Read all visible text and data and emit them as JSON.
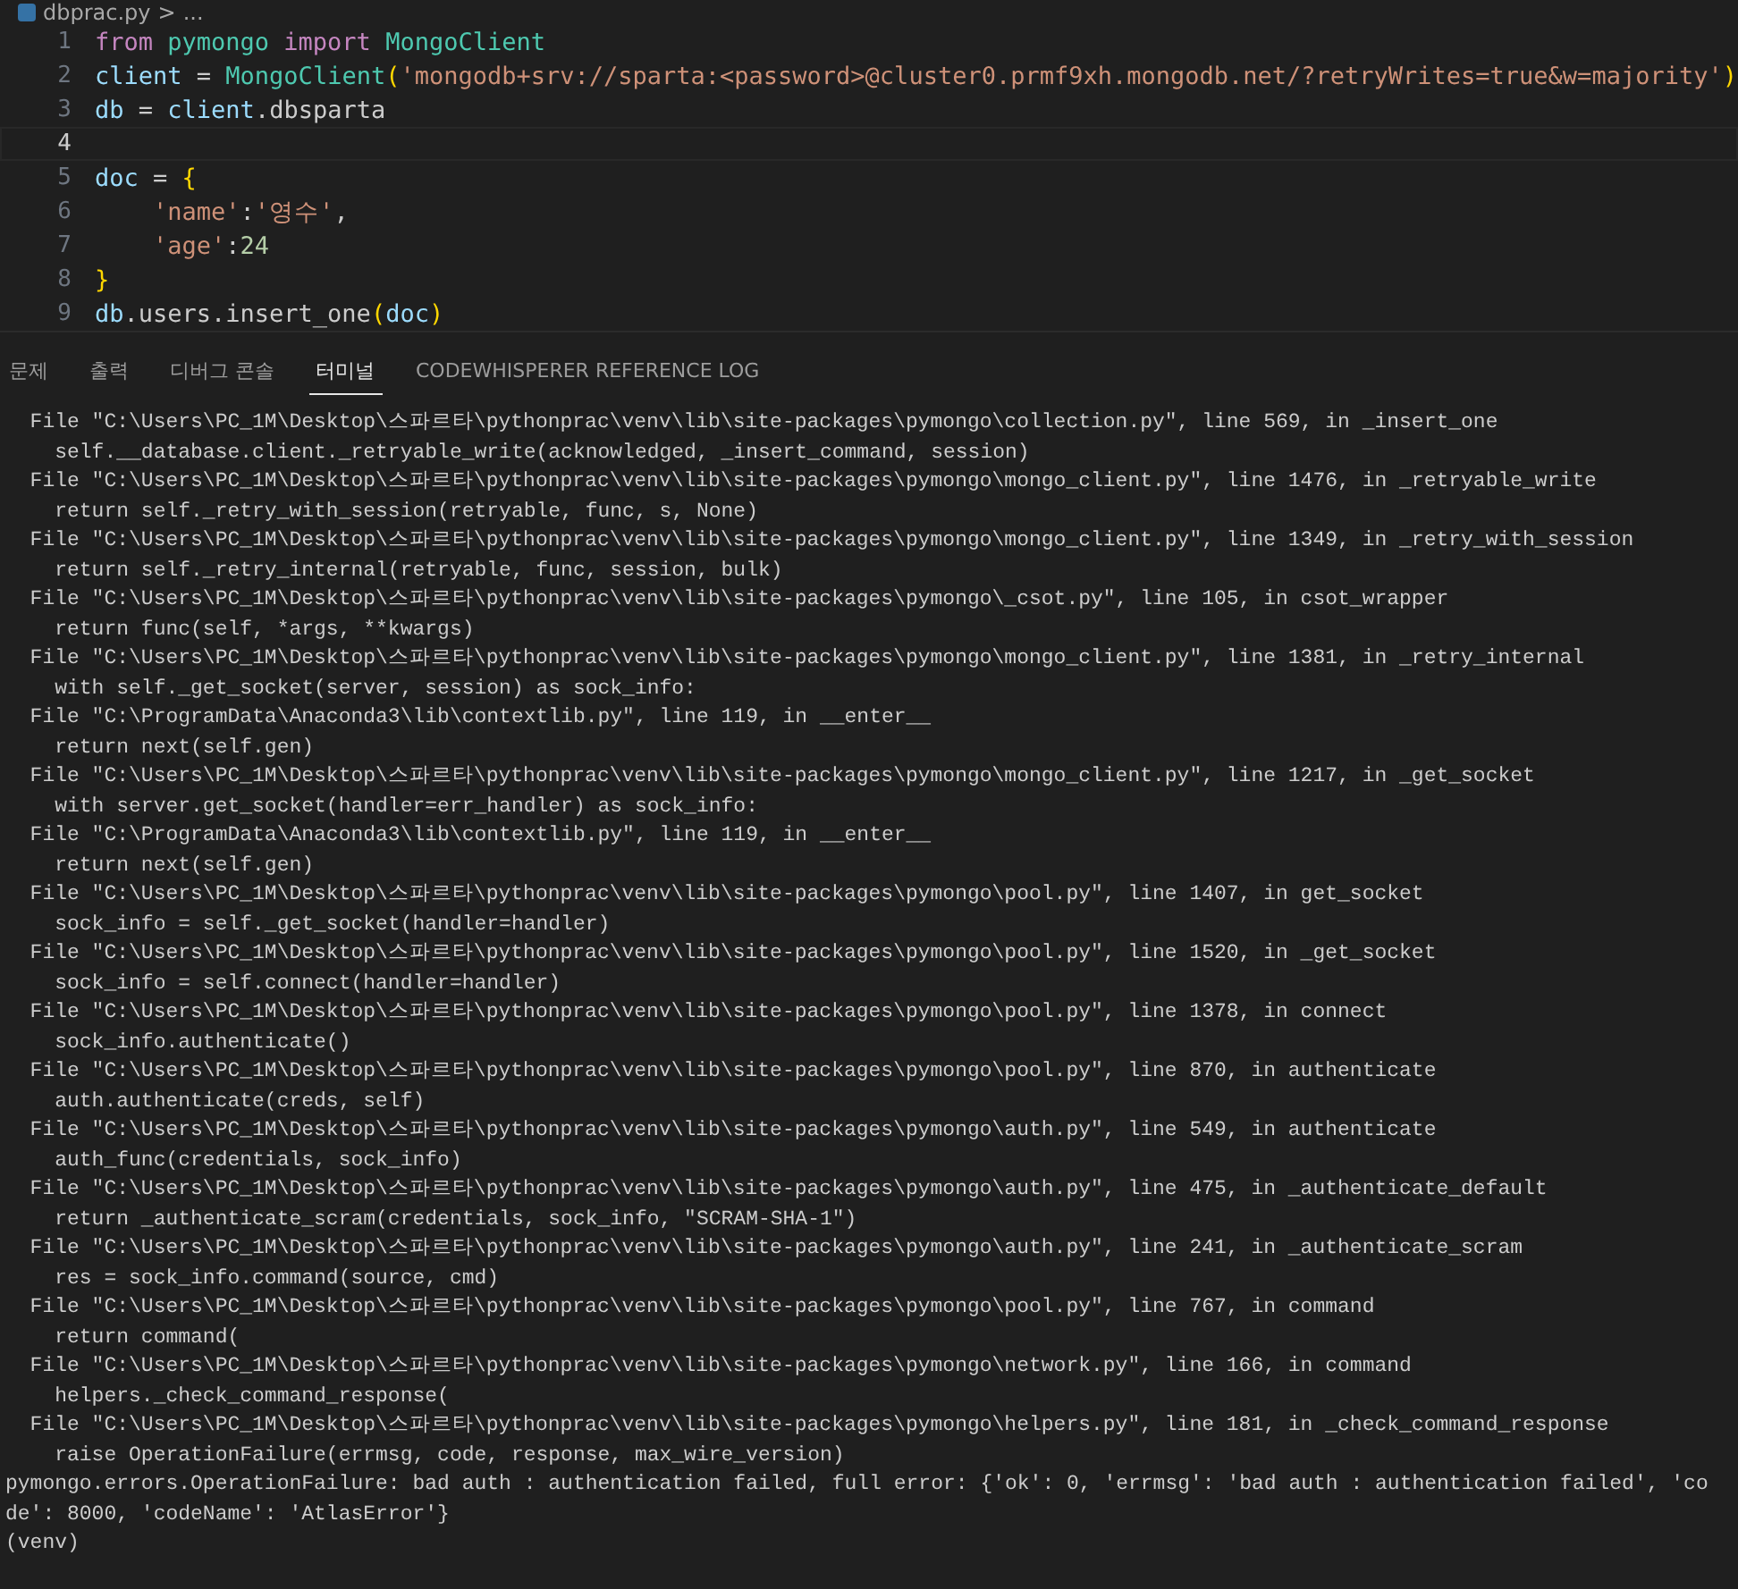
{
  "breadcrumb": {
    "file": "dbprac.py",
    "separator": ">",
    "rest": "..."
  },
  "code": [
    {
      "number": "1",
      "active": false,
      "tokens": [
        {
          "kind": "keyword",
          "text": "from "
        },
        {
          "kind": "module",
          "text": "pymongo "
        },
        {
          "kind": "keyword",
          "text": "import "
        },
        {
          "kind": "class",
          "text": "MongoClient"
        }
      ]
    },
    {
      "number": "2",
      "active": false,
      "tokens": [
        {
          "kind": "variable",
          "text": "client"
        },
        {
          "kind": "plain",
          "text": " = "
        },
        {
          "kind": "class",
          "text": "MongoClient"
        },
        {
          "kind": "bracket",
          "text": "("
        },
        {
          "kind": "string",
          "text": "'mongodb+srv://sparta:<password>@cluster0.prmf9xh.mongodb.net/?retryWrites=true&w=majority'"
        },
        {
          "kind": "bracket",
          "text": ")"
        }
      ]
    },
    {
      "number": "3",
      "active": false,
      "tokens": [
        {
          "kind": "variable",
          "text": "db"
        },
        {
          "kind": "plain",
          "text": " = "
        },
        {
          "kind": "variable",
          "text": "client"
        },
        {
          "kind": "plain",
          "text": ".dbsparta"
        }
      ]
    },
    {
      "number": "4",
      "active": true
    },
    {
      "number": "5",
      "active": false,
      "tokens": [
        {
          "kind": "variable",
          "text": "doc"
        },
        {
          "kind": "plain",
          "text": " = "
        },
        {
          "kind": "bracket",
          "text": "{"
        }
      ]
    },
    {
      "number": "6",
      "active": false,
      "indent": true,
      "tokens": [
        {
          "kind": "string",
          "text": "'name'"
        },
        {
          "kind": "plain",
          "text": ":"
        },
        {
          "kind": "string",
          "text": "'영수'"
        },
        {
          "kind": "plain",
          "text": ","
        }
      ]
    },
    {
      "number": "7",
      "active": false,
      "indent": true,
      "tokens": [
        {
          "kind": "string",
          "text": "'age'"
        },
        {
          "kind": "plain",
          "text": ":"
        },
        {
          "kind": "number",
          "text": "24"
        }
      ]
    },
    {
      "number": "8",
      "active": false,
      "tokens": [
        {
          "kind": "bracket",
          "text": "}"
        }
      ]
    },
    {
      "number": "9",
      "active": false,
      "tokens": [
        {
          "kind": "variable",
          "text": "db"
        },
        {
          "kind": "plain",
          "text": ".users.insert_one"
        },
        {
          "kind": "bracket",
          "text": "("
        },
        {
          "kind": "variable",
          "text": "doc"
        },
        {
          "kind": "bracket",
          "text": ")"
        }
      ]
    }
  ],
  "panel_tabs": [
    {
      "label": "문제",
      "selected": false
    },
    {
      "label": "출력",
      "selected": false
    },
    {
      "label": "디버그 콘솔",
      "selected": false
    },
    {
      "label": "터미널",
      "selected": true
    },
    {
      "label": "CODEWHISPERER REFERENCE LOG",
      "selected": false
    }
  ],
  "terminal": [
    "  File \"C:\\Users\\PC_1M\\Desktop\\스파르타\\pythonprac\\venv\\lib\\site-packages\\pymongo\\collection.py\", line 569, in _insert_one",
    "    self.__database.client._retryable_write(acknowledged, _insert_command, session)",
    "  File \"C:\\Users\\PC_1M\\Desktop\\스파르타\\pythonprac\\venv\\lib\\site-packages\\pymongo\\mongo_client.py\", line 1476, in _retryable_write",
    "    return self._retry_with_session(retryable, func, s, None)",
    "  File \"C:\\Users\\PC_1M\\Desktop\\스파르타\\pythonprac\\venv\\lib\\site-packages\\pymongo\\mongo_client.py\", line 1349, in _retry_with_session",
    "    return self._retry_internal(retryable, func, session, bulk)",
    "  File \"C:\\Users\\PC_1M\\Desktop\\스파르타\\pythonprac\\venv\\lib\\site-packages\\pymongo\\_csot.py\", line 105, in csot_wrapper",
    "    return func(self, *args, **kwargs)",
    "  File \"C:\\Users\\PC_1M\\Desktop\\스파르타\\pythonprac\\venv\\lib\\site-packages\\pymongo\\mongo_client.py\", line 1381, in _retry_internal",
    "    with self._get_socket(server, session) as sock_info:",
    "  File \"C:\\ProgramData\\Anaconda3\\lib\\contextlib.py\", line 119, in __enter__",
    "    return next(self.gen)",
    "  File \"C:\\Users\\PC_1M\\Desktop\\스파르타\\pythonprac\\venv\\lib\\site-packages\\pymongo\\mongo_client.py\", line 1217, in _get_socket",
    "    with server.get_socket(handler=err_handler) as sock_info:",
    "  File \"C:\\ProgramData\\Anaconda3\\lib\\contextlib.py\", line 119, in __enter__",
    "    return next(self.gen)",
    "  File \"C:\\Users\\PC_1M\\Desktop\\스파르타\\pythonprac\\venv\\lib\\site-packages\\pymongo\\pool.py\", line 1407, in get_socket",
    "    sock_info = self._get_socket(handler=handler)",
    "  File \"C:\\Users\\PC_1M\\Desktop\\스파르타\\pythonprac\\venv\\lib\\site-packages\\pymongo\\pool.py\", line 1520, in _get_socket",
    "    sock_info = self.connect(handler=handler)",
    "  File \"C:\\Users\\PC_1M\\Desktop\\스파르타\\pythonprac\\venv\\lib\\site-packages\\pymongo\\pool.py\", line 1378, in connect",
    "    sock_info.authenticate()",
    "  File \"C:\\Users\\PC_1M\\Desktop\\스파르타\\pythonprac\\venv\\lib\\site-packages\\pymongo\\pool.py\", line 870, in authenticate",
    "    auth.authenticate(creds, self)",
    "  File \"C:\\Users\\PC_1M\\Desktop\\스파르타\\pythonprac\\venv\\lib\\site-packages\\pymongo\\auth.py\", line 549, in authenticate",
    "    auth_func(credentials, sock_info)",
    "  File \"C:\\Users\\PC_1M\\Desktop\\스파르타\\pythonprac\\venv\\lib\\site-packages\\pymongo\\auth.py\", line 475, in _authenticate_default",
    "    return _authenticate_scram(credentials, sock_info, \"SCRAM-SHA-1\")",
    "  File \"C:\\Users\\PC_1M\\Desktop\\스파르타\\pythonprac\\venv\\lib\\site-packages\\pymongo\\auth.py\", line 241, in _authenticate_scram",
    "    res = sock_info.command(source, cmd)",
    "  File \"C:\\Users\\PC_1M\\Desktop\\스파르타\\pythonprac\\venv\\lib\\site-packages\\pymongo\\pool.py\", line 767, in command",
    "    return command(",
    "  File \"C:\\Users\\PC_1M\\Desktop\\스파르타\\pythonprac\\venv\\lib\\site-packages\\pymongo\\network.py\", line 166, in command",
    "    helpers._check_command_response(",
    "  File \"C:\\Users\\PC_1M\\Desktop\\스파르타\\pythonprac\\venv\\lib\\site-packages\\pymongo\\helpers.py\", line 181, in _check_command_response",
    "    raise OperationFailure(errmsg, code, response, max_wire_version)",
    "pymongo.errors.OperationFailure: bad auth : authentication failed, full error: {'ok': 0, 'errmsg': 'bad auth : authentication failed', 'co",
    "de': 8000, 'codeName': 'AtlasError'}",
    "(venv)"
  ]
}
